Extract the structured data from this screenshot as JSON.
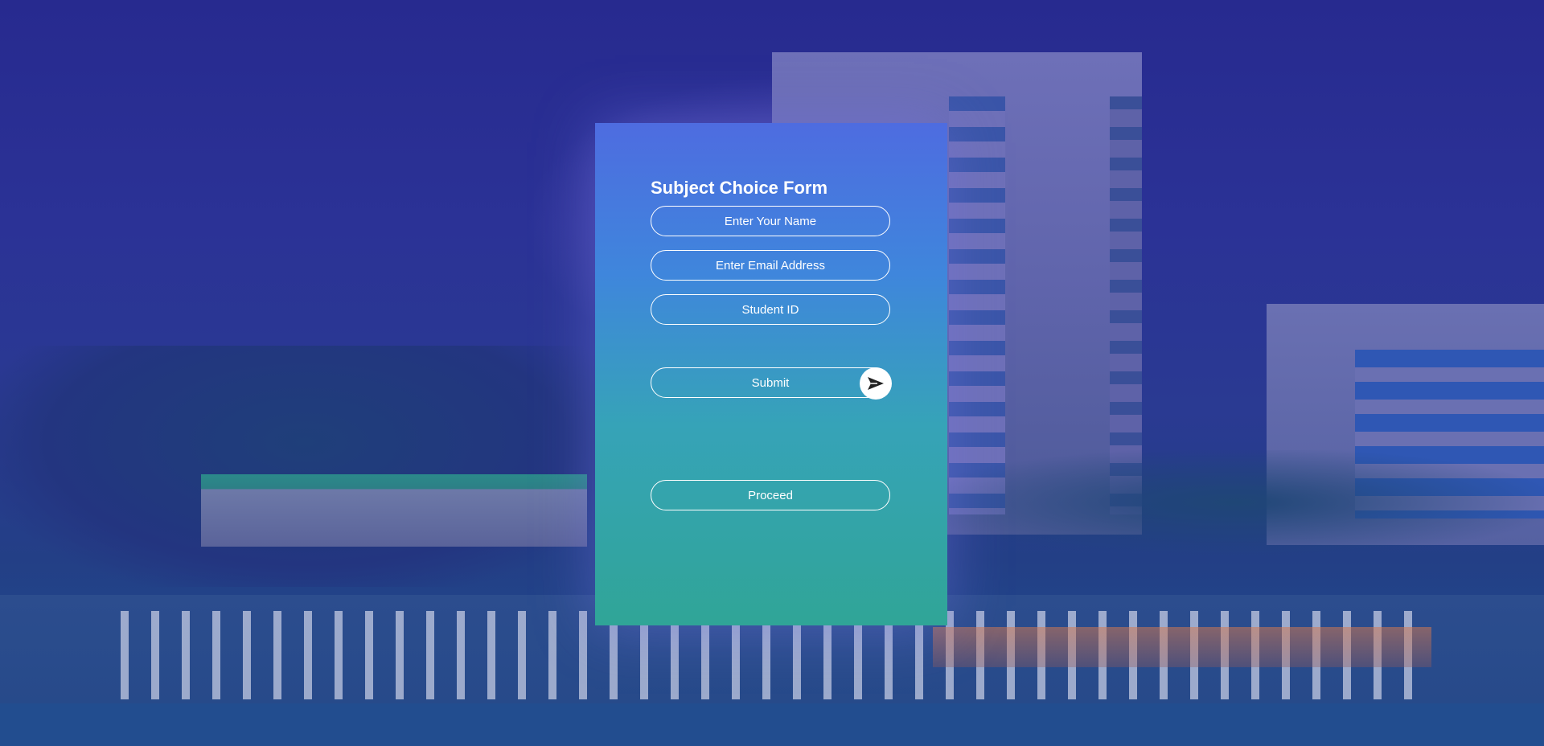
{
  "form": {
    "title": "Subject Choice Form",
    "name_placeholder": "Enter Your Name",
    "email_placeholder": "Enter Email Address",
    "student_id_placeholder": "Student ID",
    "submit_label": "Submit",
    "proceed_label": "Proceed",
    "submit_icon": "send-icon"
  },
  "colors": {
    "background_overlay": "#272a8f",
    "card_gradient_top": "#4e6ce0",
    "card_gradient_bottom": "#30a597",
    "text": "#ffffff"
  }
}
